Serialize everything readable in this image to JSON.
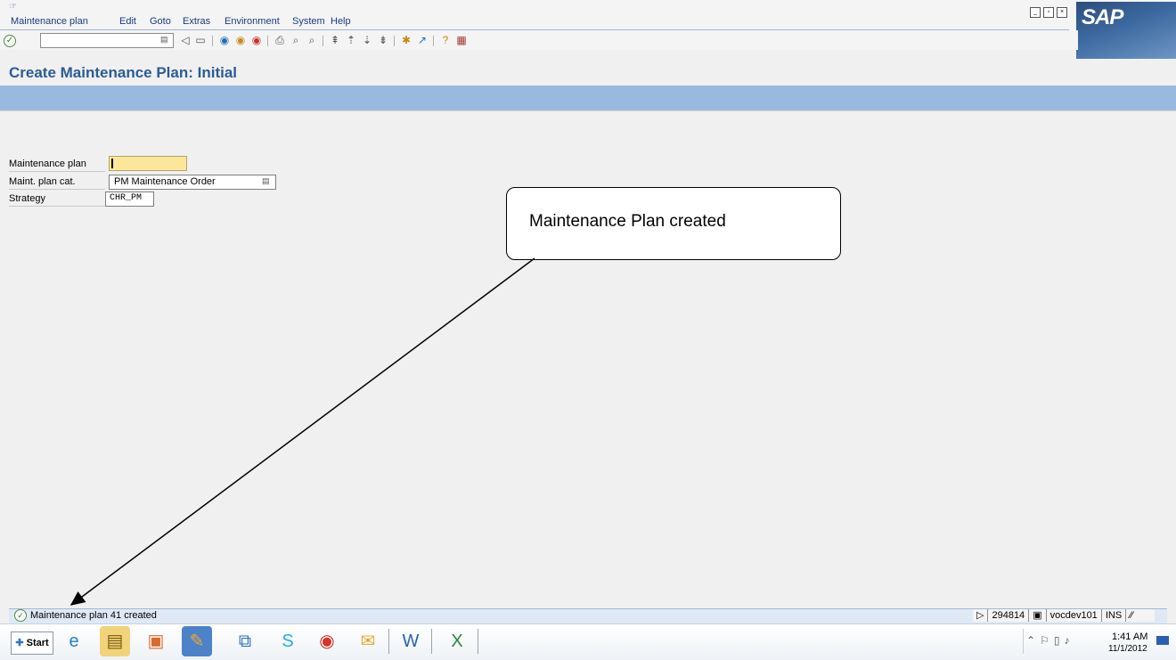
{
  "menubar": {
    "items": [
      "Maintenance plan",
      "Edit",
      "Goto",
      "Extras",
      "Environment",
      "System",
      "Help"
    ]
  },
  "logo": {
    "text": "SAP"
  },
  "header": {
    "title": "Create Maintenance Plan: Initial"
  },
  "form": {
    "plan_label": "Maintenance plan",
    "plan_value": "",
    "cat_label": "Maint. plan cat.",
    "cat_value": "PM Maintenance Order",
    "strategy_label": "Strategy",
    "strategy_value": "CHR_PM"
  },
  "callout": {
    "text": "Maintenance Plan created"
  },
  "statusbar": {
    "message": "Maintenance plan 41 created",
    "session": "294814",
    "server": "vocdev101",
    "mode": "INS"
  },
  "taskbar": {
    "start_label": "Start",
    "time": "1:41 AM",
    "date": "11/1/2012"
  },
  "colors": {
    "title_blue": "#2b5c95",
    "appbar_blue": "#9ab9de",
    "required_field": "#fbe69a"
  }
}
